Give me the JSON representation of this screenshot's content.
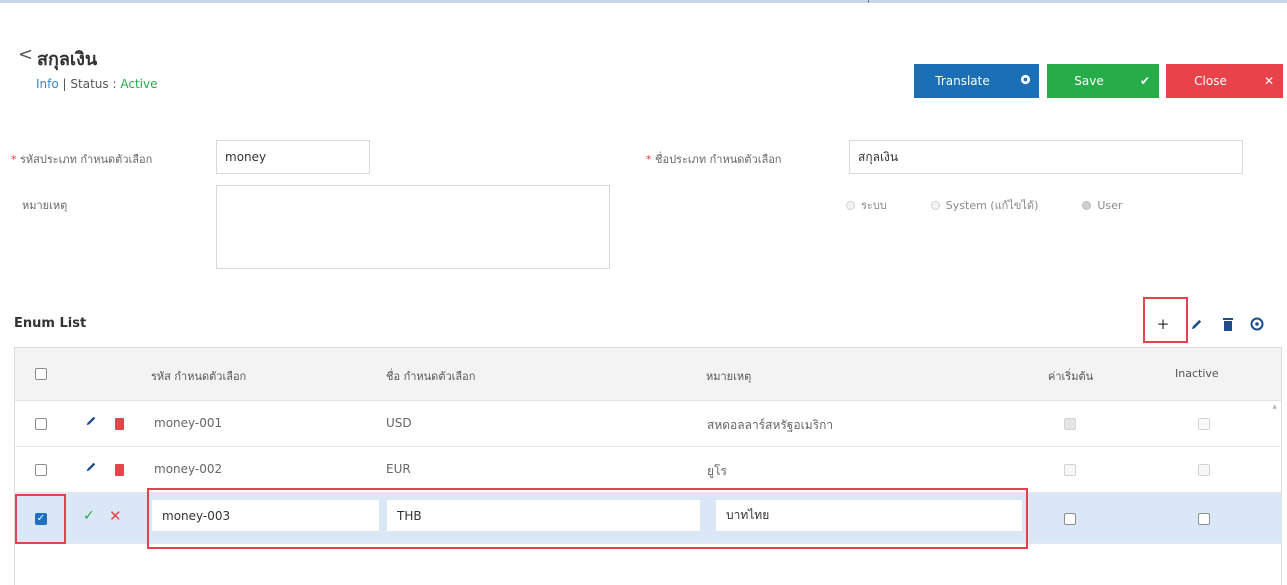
{
  "top_tick": "ʼ",
  "header": {
    "back_glyph": "<",
    "title": "สกุลเงิน",
    "info_link": "Info",
    "separator": "|",
    "status_label": "Status :",
    "status_value": "Active"
  },
  "actions": {
    "translate": "Translate",
    "save": "Save",
    "close": "Close"
  },
  "form": {
    "code_label": "รหัสประเภท กำหนดตัวเลือก",
    "code_value": "money",
    "name_label": "ชื่อประเภท กำหนดตัวเลือก",
    "name_value": "สกุลเงิน",
    "remark_label": "หมายเหตุ",
    "remark_value": "",
    "type_options": [
      "ระบบ",
      "System (แก้ไขได้)",
      "User"
    ],
    "type_selected": "User"
  },
  "enum_list": {
    "title": "Enum List",
    "columns": [
      "รหัส กำหนดตัวเลือก",
      "ชื่อ กำหนดตัวเลือก",
      "หมายเหตุ",
      "ค่าเริ่มต้น",
      "Inactive"
    ],
    "rows": [
      {
        "code": "money-001",
        "name": "USD",
        "remark": "สหดอลลาร์สหรัฐอเมริกา",
        "default": true,
        "inactive": false,
        "selected": false
      },
      {
        "code": "money-002",
        "name": "EUR",
        "remark": "ยูโร",
        "default": false,
        "inactive": false,
        "selected": false
      }
    ],
    "editing_row": {
      "code": "money-003",
      "name": "THB",
      "remark": "บาทไทย",
      "default": false,
      "inactive": false,
      "selected": true
    }
  },
  "colors": {
    "translate": "#1a6fb5",
    "save": "#26ad4a",
    "close": "#e8434a",
    "highlight": "#e0434c",
    "selected_row": "#d9e7f6"
  },
  "icons": {
    "toolbar": [
      "plus-icon",
      "pencil-icon",
      "trash-icon",
      "refresh-icon"
    ]
  }
}
